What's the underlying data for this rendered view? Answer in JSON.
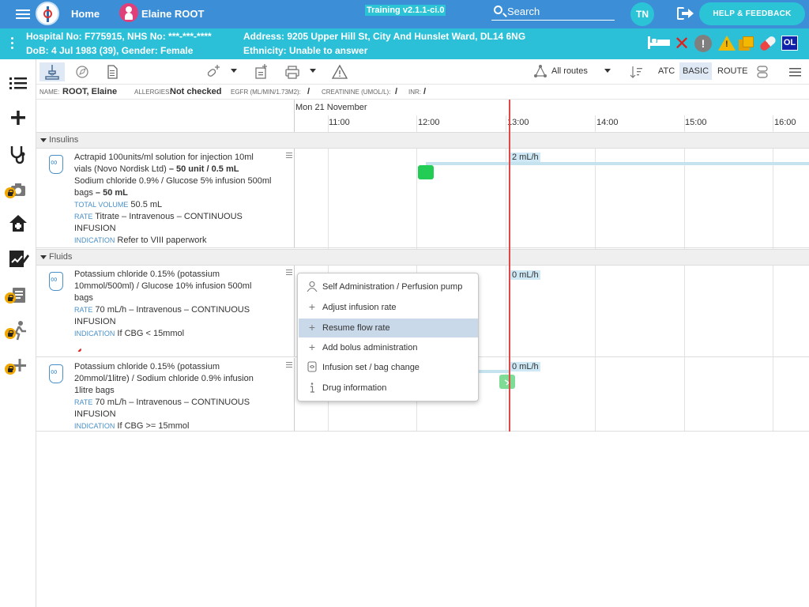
{
  "topbar": {
    "home_label": "Home",
    "patient_name": "Elaine ROOT",
    "training_badge": "Training v2.1.1-ci.0",
    "search_label": "Search",
    "user_initials": "TN",
    "help_label": "HELP & FEEDBACK",
    "colors": {
      "bar": "#3c8fd6",
      "accent": "#2bc4d6"
    }
  },
  "patient": {
    "hospital_line": "Hospital No: F775915, NHS No: ***-***-****",
    "dob_line": "DoB: 4 Jul 1983 (39), Gender: Female",
    "address_line": "Address: 9205 Upper Hill St, City And Hunslet Ward, DL14 6NG",
    "ethnicity_line": "Ethnicity: Unable to answer",
    "ol_badge": "OL"
  },
  "toolbar": {
    "routes_label": "All routes",
    "atc_label": "ATC",
    "basic_label": "BASIC",
    "route_label": "ROUTE"
  },
  "info": {
    "name_key": "NAME:",
    "name_val": "ROOT, Elaine",
    "allergies_key": "ALLERGIES:",
    "allergies_val": "Not checked",
    "egfr_key": "EGFR (ML/MIN/1.73M2):",
    "egfr_val": "/",
    "creat_key": "CREATININE (UMOL/L):",
    "creat_val": "/",
    "inr_key": "INR:",
    "inr_val": "/"
  },
  "timeline": {
    "date": "Mon 21 November",
    "ticks": [
      "11:00",
      "12:00",
      "13:00",
      "14:00",
      "15:00",
      "16:00"
    ]
  },
  "groups": [
    {
      "label": "Insulins"
    },
    {
      "label": "Fluids"
    }
  ],
  "drugs": [
    {
      "line1": "Actrapid 100units/ml solution for injection 10ml vials (Novo Nordisk Ltd)",
      "dose1": "– 50 unit / 0.5 mL",
      "line2": "Sodium chloride 0.9% / Glucose 5% infusion 500ml bags",
      "dose2": "– 50 mL",
      "total_label": "TOTAL VOLUME",
      "total_val": "50.5 mL",
      "rate_label": "RATE",
      "rate_val": "Titrate – Intravenous – CONTINUOUS INFUSION",
      "ind_label": "INDICATION",
      "ind_val": "Refer to VIII paperwork",
      "rate_marker": "2 mL/h"
    },
    {
      "line1": "Potassium chloride 0.15% (potassium 10mmol/500ml) / Glucose 10% infusion 500ml bags",
      "rate_label": "RATE",
      "rate_val": "70 mL/h – Intravenous – CONTINUOUS INFUSION",
      "ind_label": "INDICATION",
      "ind_val": "If CBG < 15mmol",
      "rate_marker": "0 mL/h"
    },
    {
      "line1": "Potassium chloride 0.15% (potassium 20mmol/1litre) / Sodium chloride 0.9% infusion 1litre bags",
      "rate_label": "RATE",
      "rate_val": "70 mL/h – Intravenous – CONTINUOUS INFUSION",
      "ind_label": "INDICATION",
      "ind_val": "If CBG >= 15mmol",
      "rate_marker": "0 mL/h"
    }
  ],
  "context_menu": {
    "items": [
      {
        "label": "Self Administration / Perfusion pump",
        "icon": "person-icon"
      },
      {
        "label": "Adjust infusion rate",
        "icon": "plus-icon"
      },
      {
        "label": "Resume flow rate",
        "icon": "plus-icon"
      },
      {
        "label": "Add bolus administration",
        "icon": "plus-icon"
      },
      {
        "label": "Infusion set / bag change",
        "icon": "infusion-bag-icon"
      },
      {
        "label": "Drug information",
        "icon": "info-icon"
      }
    ]
  }
}
